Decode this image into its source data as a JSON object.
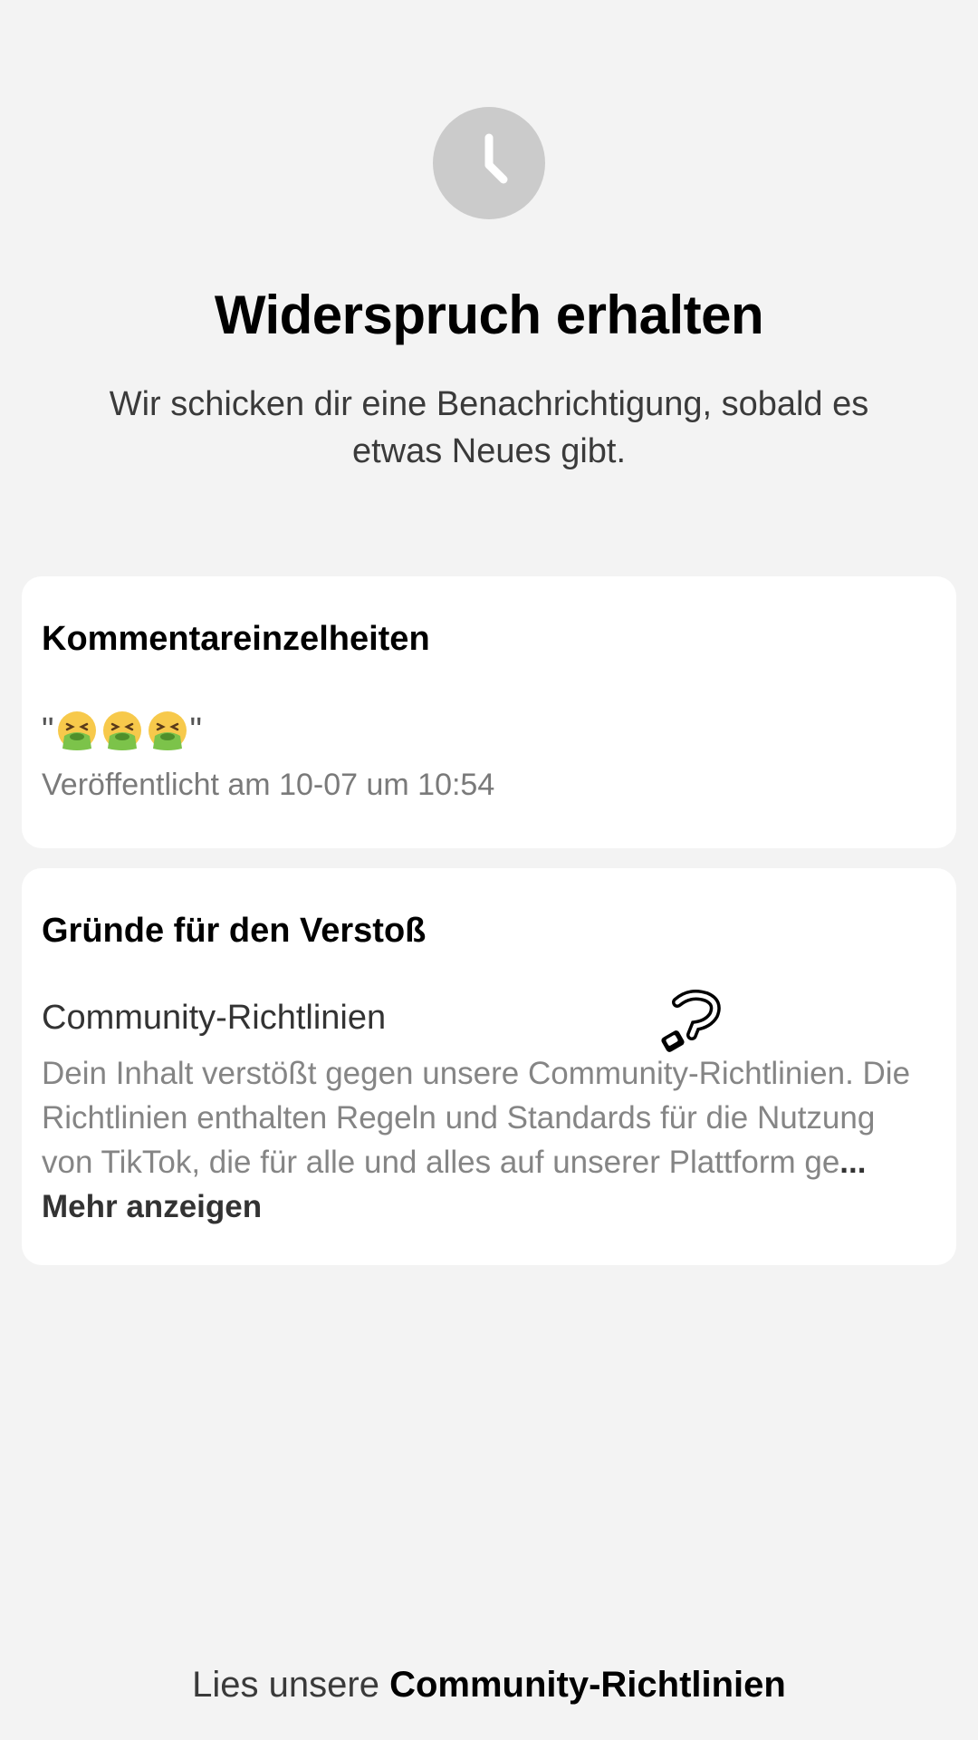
{
  "header": {
    "status_icon": "clock-icon",
    "title": "Widerspruch erhalten",
    "subtitle": "Wir schicken dir eine Benachrichtigung, sobald es etwas Neues gibt."
  },
  "comment_card": {
    "title": "Kommentareinzelheiten",
    "quote_open": "\"",
    "quote_close": "\"",
    "emoji_icons": [
      "vomiting-face-icon",
      "vomiting-face-icon",
      "vomiting-face-icon"
    ],
    "published": "Veröffentlicht am 10-07 um 10:54"
  },
  "reasons_card": {
    "title": "Gründe für den Verstoß",
    "guideline_name": "Community-Richtlinien",
    "description": "Dein Inhalt verstößt gegen unsere Community-Richtlinien. Die Richtlinien enthalten Regeln und Standards für die Nutzung von TikTok, die für alle und alles auf unserer Plattform ge",
    "ellipsis": "...",
    "more_label": "Mehr anzeigen"
  },
  "footer": {
    "prefix": "Lies unsere ",
    "link_label": "Community-Richtlinien"
  },
  "colors": {
    "background": "#f3f3f3",
    "card": "#ffffff",
    "icon_circle": "#cbcbcb",
    "muted_text": "#858585"
  }
}
